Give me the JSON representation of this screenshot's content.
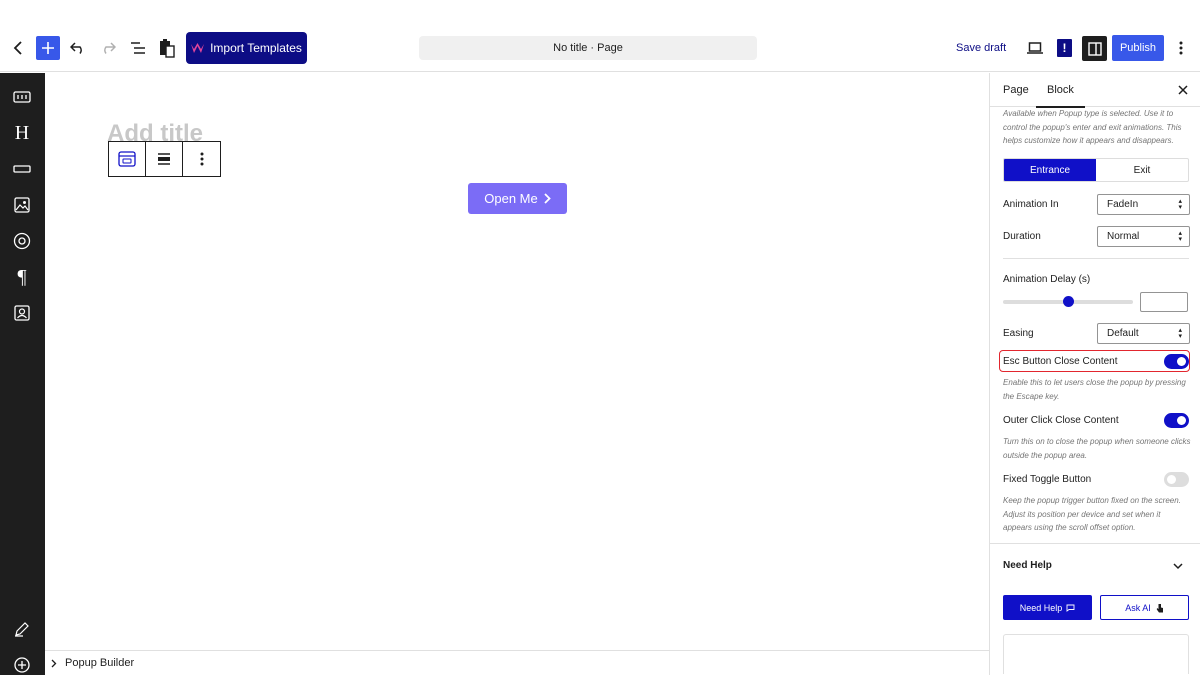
{
  "toolbar": {
    "import_label": "Import Templates",
    "doc_title": "No title · Page",
    "save_draft": "Save draft",
    "exclam": "!",
    "publish": "Publish"
  },
  "canvas": {
    "title_placeholder": "Add title",
    "button_label": "Open Me"
  },
  "breadcrumb": {
    "item": "Popup Builder"
  },
  "panel": {
    "tabs": [
      "Page",
      "Block"
    ],
    "active_tab": "Block",
    "animation_help": "Available when Popup type is selected. Use it to control the popup's enter and exit animations. This helps customize how it appears and disappears.",
    "segments": [
      "Entrance",
      "Exit"
    ],
    "active_segment": "Entrance",
    "animation_in_label": "Animation In",
    "animation_in_value": "FadeIn",
    "duration_label": "Duration",
    "duration_value": "Normal",
    "delay_label": "Animation Delay (s)",
    "delay_slider_fraction": 0.5,
    "delay_value": "",
    "easing_label": "Easing",
    "easing_value": "Default",
    "esc_label": "Esc Button Close Content",
    "esc_on": true,
    "esc_help": "Enable this to let users close the popup by pressing the Escape key.",
    "outer_label": "Outer Click Close Content",
    "outer_on": true,
    "outer_help": "Turn this on to close the popup when someone clicks outside the popup area.",
    "fixed_label": "Fixed Toggle Button",
    "fixed_on": false,
    "fixed_help": "Keep the popup trigger button fixed on the screen. Adjust its position per device and set when it appears using the scroll offset option.",
    "need_help_heading": "Need Help",
    "need_help_button": "Need Help",
    "ask_ai_button": "Ask AI"
  },
  "colors": {
    "accent": "#1010c8",
    "wp_blue": "#3858e9",
    "brand_dark": "#0d0d85",
    "open_me_bg": "#7b6cf6",
    "highlight": "#e2262e"
  },
  "icons": {
    "left_rail": [
      "columns-icon",
      "heading-icon",
      "button-icon",
      "image-icon",
      "circle-icon",
      "paragraph-icon",
      "contact-icon",
      "pencil-icon",
      "plus-circle-icon"
    ]
  }
}
